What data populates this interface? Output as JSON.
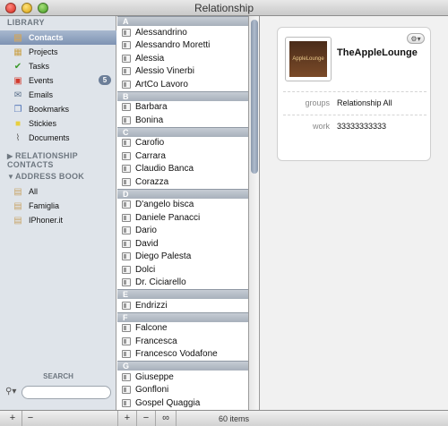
{
  "window": {
    "title": "Relationship"
  },
  "sidebar": {
    "library_header": "LIBRARY",
    "library_items": [
      {
        "label": "Contacts",
        "icon": "contacts-book-icon",
        "selected": true
      },
      {
        "label": "Projects",
        "icon": "projects-icon"
      },
      {
        "label": "Tasks",
        "icon": "checkmark-icon"
      },
      {
        "label": "Events",
        "icon": "calendar-icon",
        "badge": "5"
      },
      {
        "label": "Emails",
        "icon": "envelope-icon"
      },
      {
        "label": "Bookmarks",
        "icon": "bookmarks-icon"
      },
      {
        "label": "Stickies",
        "icon": "sticky-note-icon"
      },
      {
        "label": "Documents",
        "icon": "paperclip-icon"
      }
    ],
    "relationship_header": "RELATIONSHIP CONTACTS",
    "addressbook_header": "ADDRESS BOOK",
    "addressbook_items": [
      {
        "label": "All"
      },
      {
        "label": "Famiglia"
      },
      {
        "label": "IPhoner.it"
      }
    ],
    "search_header": "SEARCH",
    "search_placeholder": ""
  },
  "contacts": [
    {
      "letter": "A",
      "names": [
        "Alessandrino",
        "Alessandro Moretti",
        "Alessia",
        "Alessio Vinerbi",
        "ArtCo Lavoro"
      ]
    },
    {
      "letter": "B",
      "names": [
        "Barbara",
        "Bonina"
      ]
    },
    {
      "letter": "C",
      "names": [
        "Carofio",
        "Carrara",
        "Claudio Banca",
        "Corazza"
      ]
    },
    {
      "letter": "D",
      "names": [
        "D'angelo bisca",
        "Daniele Panacci",
        "Dario",
        "David",
        "Diego Palesta",
        "Dolci",
        "Dr. Ciciarello"
      ]
    },
    {
      "letter": "E",
      "names": [
        "Endrizzi"
      ]
    },
    {
      "letter": "F",
      "names": [
        "Falcone",
        "Francesca",
        "Francesco Vodafone"
      ]
    },
    {
      "letter": "G",
      "names": [
        "Giuseppe",
        "Gonfloni",
        "Gospel Quaggia"
      ]
    }
  ],
  "detail": {
    "name": "TheAppleLounge",
    "photo_text": "AppleLounge",
    "gear_label": "⚙▾",
    "fields": [
      {
        "label": "groups",
        "value": "Relationship All"
      },
      {
        "label": "work",
        "value": "33333333333"
      }
    ]
  },
  "bottombar": {
    "add_label": "+",
    "remove_label": "−",
    "link_label": "∞",
    "items_count": "60 items"
  }
}
